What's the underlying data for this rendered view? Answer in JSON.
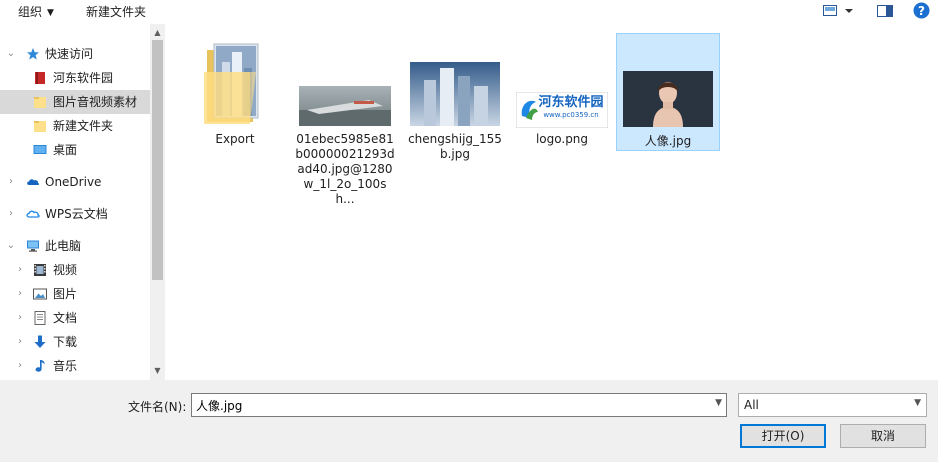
{
  "toolbar": {
    "organize_label": "组织",
    "new_folder_label": "新建文件夹"
  },
  "nav": {
    "items": [
      {
        "label": "快速访问",
        "icon": "star-icon",
        "expanded": true
      },
      {
        "label": "河东软件园",
        "icon": "red-book-icon"
      },
      {
        "label": "图片音视频素材",
        "icon": "folder-icon",
        "selected": true
      },
      {
        "label": "新建文件夹",
        "icon": "folder-icon"
      },
      {
        "label": "桌面",
        "icon": "desktop-icon"
      },
      {
        "label": "OneDrive",
        "icon": "cloud-icon"
      },
      {
        "label": "WPS云文档",
        "icon": "wps-cloud-icon"
      },
      {
        "label": "此电脑",
        "icon": "computer-icon",
        "expanded": true
      },
      {
        "label": "视频",
        "icon": "video-icon"
      },
      {
        "label": "图片",
        "icon": "pictures-icon"
      },
      {
        "label": "文档",
        "icon": "documents-icon"
      },
      {
        "label": "下载",
        "icon": "download-icon"
      },
      {
        "label": "音乐",
        "icon": "music-icon"
      }
    ]
  },
  "files": [
    {
      "name": "Export",
      "type": "folder"
    },
    {
      "name": "01ebec5985e81b00000021293dad40.jpg@1280w_1l_2o_100sh...",
      "type": "image"
    },
    {
      "name": "chengshijg_155b.jpg",
      "type": "image"
    },
    {
      "name": "logo.png",
      "type": "image",
      "logo_text": "河东软件园",
      "logo_url": "www.pc0359.cn"
    },
    {
      "name": "人像.jpg",
      "type": "image",
      "selected": true
    }
  ],
  "bottom": {
    "filename_label": "文件名(N):",
    "filename_value": "人像.jpg",
    "filetype_value": "All",
    "open_label": "打开(O)",
    "cancel_label": "取消"
  },
  "colors": {
    "selection_bg": "#cce8ff",
    "selection_border": "#99d1ff",
    "nav_selected": "#d9d9d9",
    "primary_border": "#0078d7",
    "help_blue": "#1a6fd1"
  }
}
